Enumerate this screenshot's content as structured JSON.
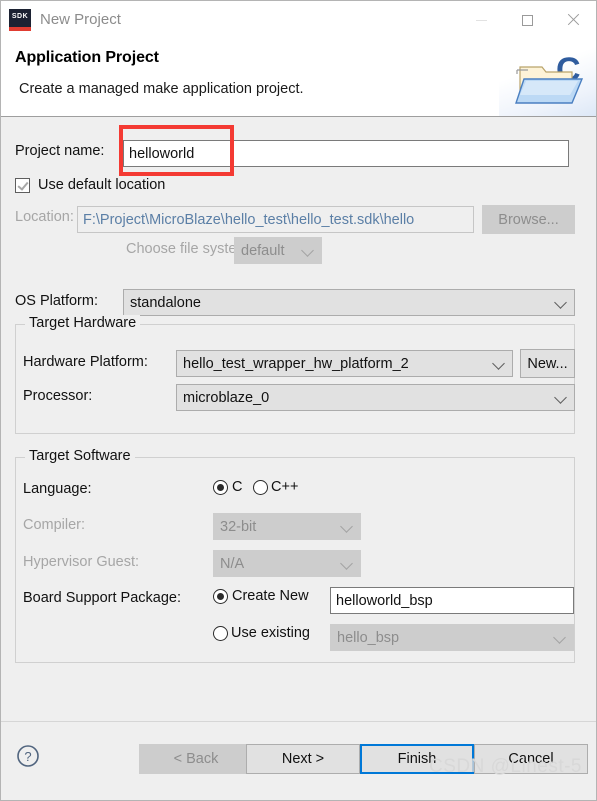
{
  "window": {
    "title": "New Project",
    "app_icon_label": "SDK",
    "controls": {
      "minimize": "minimize",
      "maximize": "maximize",
      "close": "close"
    }
  },
  "header": {
    "title": "Application Project",
    "subtitle": "Create a managed make application project.",
    "graphic": "c-project-folder-icon"
  },
  "form": {
    "project_name": {
      "label": "Project name:",
      "value": "helloworld",
      "placeholder": ""
    },
    "use_default_location": {
      "label": "Use default location",
      "checked": true
    },
    "location": {
      "label": "Location:",
      "value": "F:\\Project\\MicroBlaze\\hello_test\\hello_test.sdk\\hello",
      "browse_label": "Browse...",
      "enabled": false
    },
    "file_system": {
      "label": "Choose file system:",
      "value": "default",
      "enabled": false
    },
    "os_platform": {
      "label": "OS Platform:",
      "value": "standalone"
    }
  },
  "target_hardware": {
    "legend": "Target Hardware",
    "hardware_platform": {
      "label": "Hardware Platform:",
      "value": "hello_test_wrapper_hw_platform_2",
      "new_label": "New..."
    },
    "processor": {
      "label": "Processor:",
      "value": "microblaze_0"
    }
  },
  "target_software": {
    "legend": "Target Software",
    "language": {
      "label": "Language:",
      "options": [
        "C",
        "C++"
      ],
      "selected": "C"
    },
    "compiler": {
      "label": "Compiler:",
      "value": "32-bit",
      "enabled": false
    },
    "hypervisor_guest": {
      "label": "Hypervisor Guest:",
      "value": "N/A",
      "enabled": false
    },
    "board_support_package": {
      "label": "Board Support Package:",
      "create_new_label": "Create New",
      "create_new_value": "helloworld_bsp",
      "use_existing_label": "Use existing",
      "use_existing_value": "hello_bsp",
      "selected": "Create New"
    }
  },
  "footer": {
    "help_label": "?",
    "back_label": "< Back",
    "next_label": "Next >",
    "finish_label": "Finish",
    "cancel_label": "Cancel",
    "watermark": "CSDN @Linest-5"
  },
  "annotation": {
    "color": "#f43a33",
    "target": "project-name-field"
  }
}
